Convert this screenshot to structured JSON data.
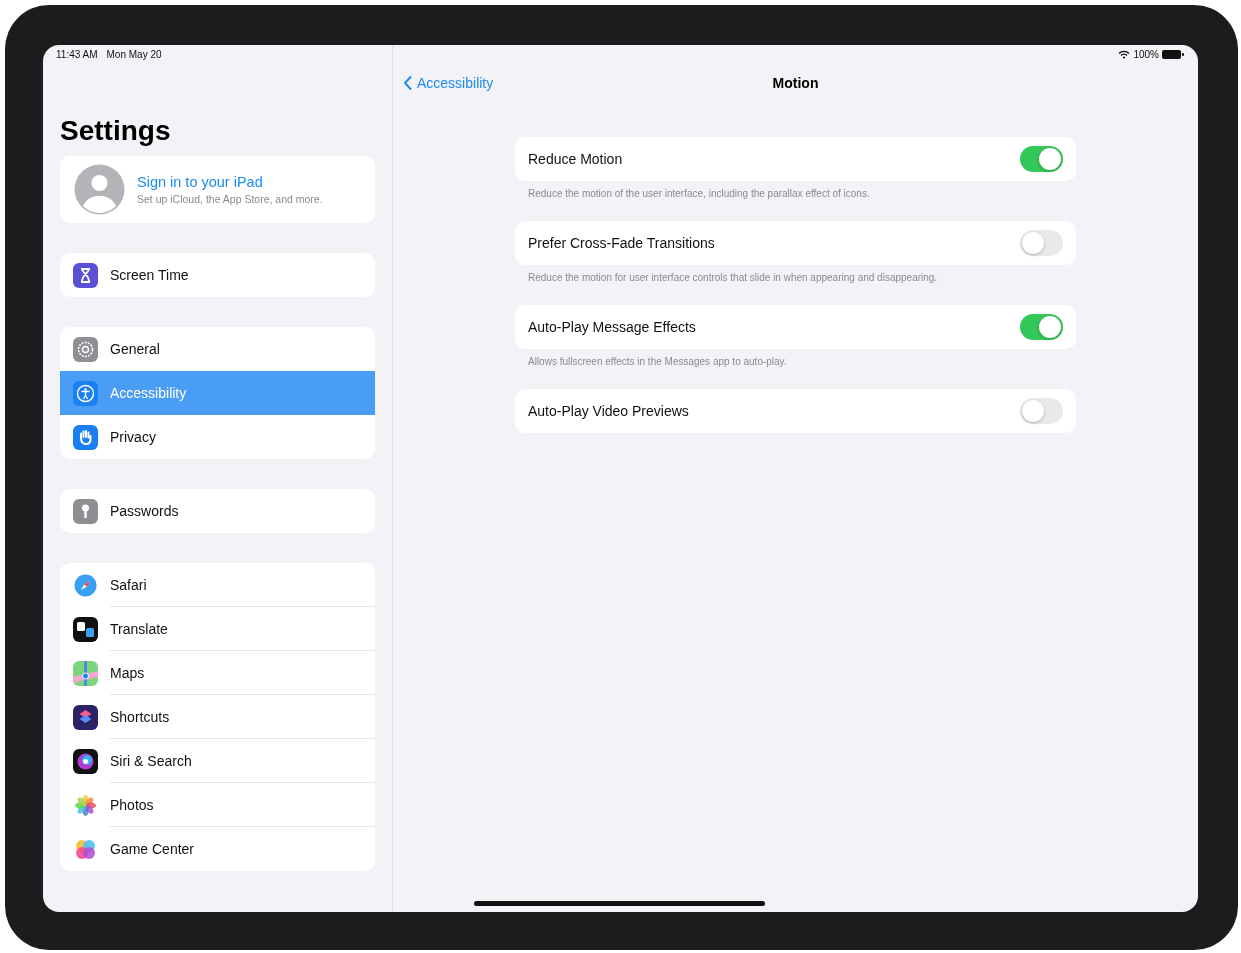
{
  "status_bar": {
    "time": "11:43 AM",
    "date": "Mon May 20",
    "battery": "100%"
  },
  "sidebar": {
    "title": "Settings",
    "profile": {
      "title": "Sign in to your iPad",
      "subtitle": "Set up iCloud, the App Store, and more."
    },
    "groups": [
      [
        {
          "label": "Screen Time",
          "kind": "hourglass",
          "selected": false
        }
      ],
      [
        {
          "label": "General",
          "kind": "gear",
          "selected": false
        },
        {
          "label": "Accessibility",
          "kind": "accessibility",
          "selected": true
        },
        {
          "label": "Privacy",
          "kind": "hand",
          "selected": false
        }
      ],
      [
        {
          "label": "Passwords",
          "kind": "key",
          "selected": false
        }
      ],
      [
        {
          "label": "Safari",
          "kind": "compass",
          "selected": false
        },
        {
          "label": "Translate",
          "kind": "translate",
          "selected": false
        },
        {
          "label": "Maps",
          "kind": "map",
          "selected": false
        },
        {
          "label": "Shortcuts",
          "kind": "shortcuts",
          "selected": false
        },
        {
          "label": "Siri & Search",
          "kind": "siri",
          "selected": false
        },
        {
          "label": "Photos",
          "kind": "flower",
          "selected": false
        },
        {
          "label": "Game Center",
          "kind": "bubbles",
          "selected": false
        }
      ]
    ]
  },
  "detail": {
    "back": "Accessibility",
    "title": "Motion",
    "settings": [
      {
        "label": "Reduce Motion",
        "on": true,
        "footer": "Reduce the motion of the user interface, including the parallax effect of icons."
      },
      {
        "label": "Prefer Cross-Fade Transitions",
        "on": false,
        "footer": "Reduce the motion for user interface controls that slide in when appearing and disappearing."
      },
      {
        "label": "Auto-Play Message Effects",
        "on": true,
        "footer": "Allows fullscreen effects in the Messages app to auto-play."
      },
      {
        "label": "Auto-Play Video Previews",
        "on": false
      }
    ]
  }
}
